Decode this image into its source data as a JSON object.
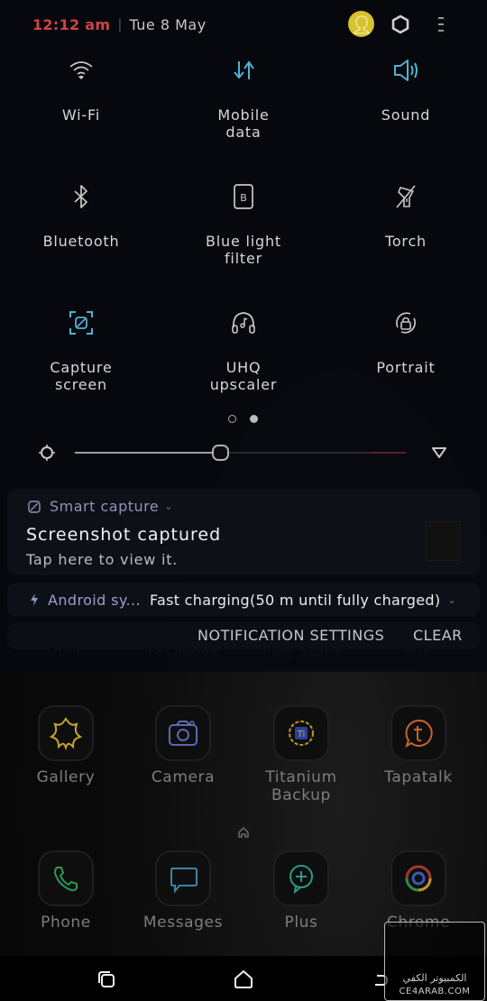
{
  "status_bar": {
    "time": "12:12 am",
    "separator": "|",
    "date": "Tue 8 May"
  },
  "quick_settings": {
    "tiles": [
      {
        "id": "wifi",
        "label": "Wi-Fi",
        "icon": "wifi-icon",
        "active": false
      },
      {
        "id": "mobile-data",
        "label": "Mobile\ndata",
        "icon": "mobile-data-icon",
        "active": true
      },
      {
        "id": "sound",
        "label": "Sound",
        "icon": "sound-icon",
        "active": true
      },
      {
        "id": "bluetooth",
        "label": "Bluetooth",
        "icon": "bluetooth-icon",
        "active": false
      },
      {
        "id": "blue-light-filter",
        "label": "Blue light\nfilter",
        "icon": "blue-light-filter-icon",
        "active": false
      },
      {
        "id": "torch",
        "label": "Torch",
        "icon": "torch-icon",
        "active": false
      },
      {
        "id": "capture-screen",
        "label": "Capture\nscreen",
        "icon": "capture-screen-icon",
        "active": true
      },
      {
        "id": "uhq-upscaler",
        "label": "UHQ\nupscaler",
        "icon": "uhq-upscaler-icon",
        "active": false
      },
      {
        "id": "portrait",
        "label": "Portrait",
        "icon": "portrait-lock-icon",
        "active": false
      }
    ],
    "page_indicator": {
      "pages": 2,
      "current": 2
    },
    "brightness": {
      "level_percent": 44
    }
  },
  "notifications": [
    {
      "app": "Smart capture",
      "title": "Screenshot captured",
      "body": "Tap here to view it."
    },
    {
      "app": "Android sy...",
      "text": "Fast charging(50 m until fully charged)"
    }
  ],
  "notification_actions": {
    "settings": "NOTIFICATION SETTINGS",
    "clear": "CLEAR"
  },
  "home_screen": {
    "obscured_row": [
      "Uber",
      "Facebook",
      "Play Store",
      "MIX"
    ],
    "apps_row1": [
      {
        "label": "Gallery",
        "icon": "gallery-icon"
      },
      {
        "label": "Camera",
        "icon": "camera-icon"
      },
      {
        "label": "Titanium\nBackup",
        "icon": "titanium-backup-icon"
      },
      {
        "label": "Tapatalk",
        "icon": "tapatalk-icon"
      }
    ],
    "dock": [
      {
        "label": "Phone",
        "icon": "phone-icon"
      },
      {
        "label": "Messages",
        "icon": "messages-icon"
      },
      {
        "label": "Plus",
        "icon": "plus-icon"
      },
      {
        "label": "Chrome",
        "icon": "chrome-icon"
      }
    ]
  },
  "watermark": {
    "arabic": "الكمبيوتر الكفي",
    "text": "CE4ARAB.COM"
  },
  "colors": {
    "time": "#d2424a",
    "accent_active": "#4fb3d4",
    "avatar": "#d8c12c"
  }
}
